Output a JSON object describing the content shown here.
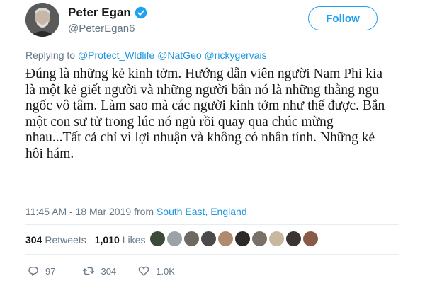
{
  "author": {
    "display_name": "Peter Egan",
    "handle": "@PeterEgan6",
    "verified_icon": "verified-badge-icon"
  },
  "follow_label": "Follow",
  "reply": {
    "prefix": "Replying to",
    "mentions": [
      "@Protect_Wldlife",
      "@NatGeo",
      "@rickygervais"
    ]
  },
  "tweet": {
    "lines": [
      "Đúng là những kẻ kinh tởm. Hướng dẫn viên người Nam Phi kia",
      "là một kẻ giết người và những người bắn nó là những thằng ngu",
      "ngốc vô tâm. Làm sao mà các người kinh tởm như thế được. Bắn",
      "một con sư tử trong lúc nó ngủ rồi quay qua chúc mừng",
      "nhau...Tất cả chỉ vì lợi nhuận và không có nhân tính. Những kẻ",
      "hôi hám."
    ]
  },
  "meta": {
    "time": "11:45 AM - 18 Mar 2019",
    "from": "from",
    "location": "South East, England"
  },
  "stats": {
    "retweets_count": "304",
    "retweets_label": "Retweets",
    "likes_count": "1,010",
    "likes_label": "Likes"
  },
  "likers": [
    "#3d4a3a",
    "#9aa3a8",
    "#6e6a63",
    "#4a4a4a",
    "#b08a6e",
    "#2e2a26",
    "#7a7068",
    "#c9b8a0",
    "#3a3530",
    "#8a5a48"
  ],
  "actions": {
    "replies": "97",
    "retweets": "304",
    "likes": "1.0K"
  },
  "colors": {
    "accent": "#1da1f2",
    "link": "#1b95e0",
    "muted": "#657786"
  }
}
